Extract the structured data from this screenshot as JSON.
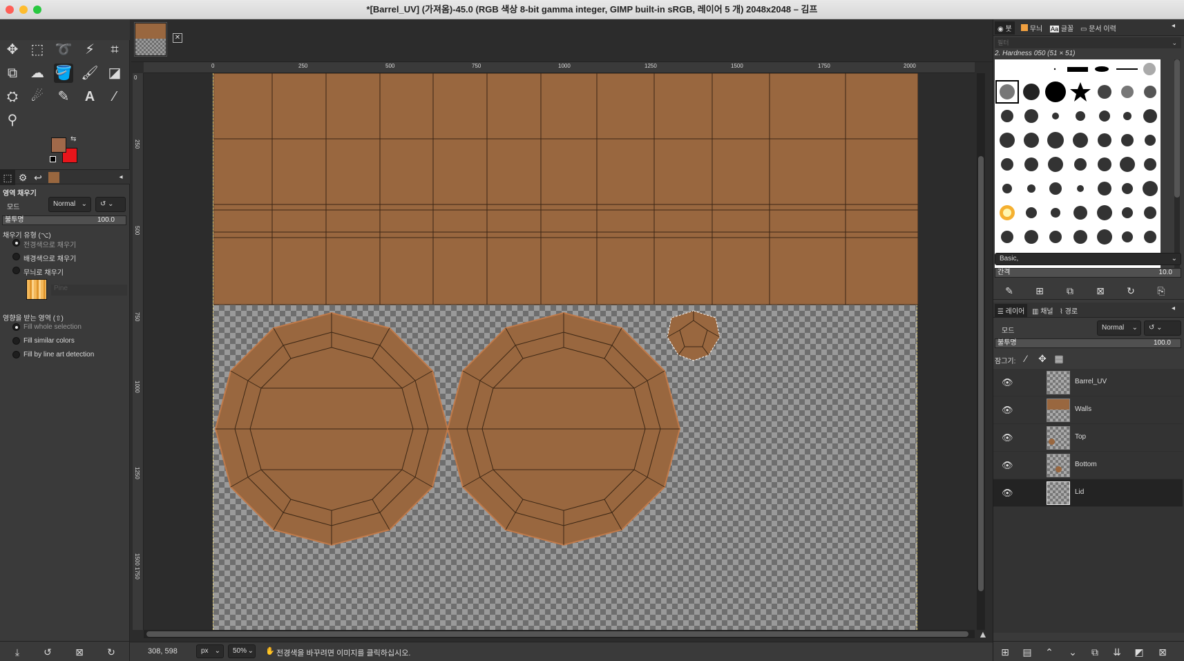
{
  "window": {
    "title": "*[Barrel_UV] (가져옴)-45.0 (RGB 색상 8-bit gamma integer, GIMP built-in sRGB, 레이어 5 개) 2048x2048 – 김프"
  },
  "toolbox": {
    "tools": [
      "move-icon",
      "rect-select-icon",
      "lasso-icon",
      "fuzzy-select-icon",
      "crop-icon",
      "transform-icon",
      "warp-icon",
      "bucket-fill-icon",
      "paintbrush-icon",
      "eraser-icon",
      "clone-icon",
      "smudge-icon",
      "paths-icon",
      "text-icon",
      "color-picker-icon",
      "zoom-icon"
    ],
    "fg_color": "#a0694a",
    "bg_color": "#e8151b"
  },
  "tool_options": {
    "title": "영역 채우기",
    "mode_label": "모드",
    "mode_value": "Normal",
    "opacity_label": "불투명",
    "opacity_value": "100.0",
    "fill_type_label": "채우기 유형 (⌥)",
    "fill_types": [
      "전경색으로 채우기",
      "배경색으로 채우기",
      "무늬로 채우기"
    ],
    "fill_type_selected": 0,
    "pattern_name": "Pine",
    "affected_label": "영향을 받는 영역 (⇧)",
    "affected": [
      "Fill whole selection",
      "Fill similar colors",
      "Fill by line art detection"
    ],
    "affected_selected": 0
  },
  "ruler": {
    "h_ticks": [
      "0",
      "250",
      "500",
      "750",
      "1000",
      "1250",
      "1500",
      "1750",
      "2000"
    ],
    "v_ticks": [
      "0",
      "250",
      "500",
      "750",
      "1000",
      "1250",
      "1500",
      "1750"
    ]
  },
  "status": {
    "coords": "308, 598",
    "unit": "px",
    "zoom": "50%",
    "message": "전경색을 바꾸려면 이미지를 클릭하십시오."
  },
  "brushes_panel": {
    "tabs": [
      "붓",
      "무늬",
      "글꼴",
      "문서 이력"
    ],
    "filter_placeholder": "필터",
    "brush_name": "2. Hardness 050 (51 × 51)",
    "preset": "Basic,",
    "spacing_label": "간격",
    "spacing_value": "10.0"
  },
  "layers_panel": {
    "tabs": [
      "레이어",
      "채널",
      "경로"
    ],
    "mode_label": "모드",
    "mode_value": "Normal",
    "opacity_label": "불투명",
    "opacity_value": "100.0",
    "lock_label": "잠그기:",
    "layers": [
      {
        "name": "Barrel_UV"
      },
      {
        "name": "Walls"
      },
      {
        "name": "Top"
      },
      {
        "name": "Bottom"
      },
      {
        "name": "Lid"
      }
    ],
    "selected_layer": 4
  },
  "colors": {
    "wood": "#99673f",
    "panel": "#3a3a3a",
    "dark": "#2c2c2c"
  }
}
